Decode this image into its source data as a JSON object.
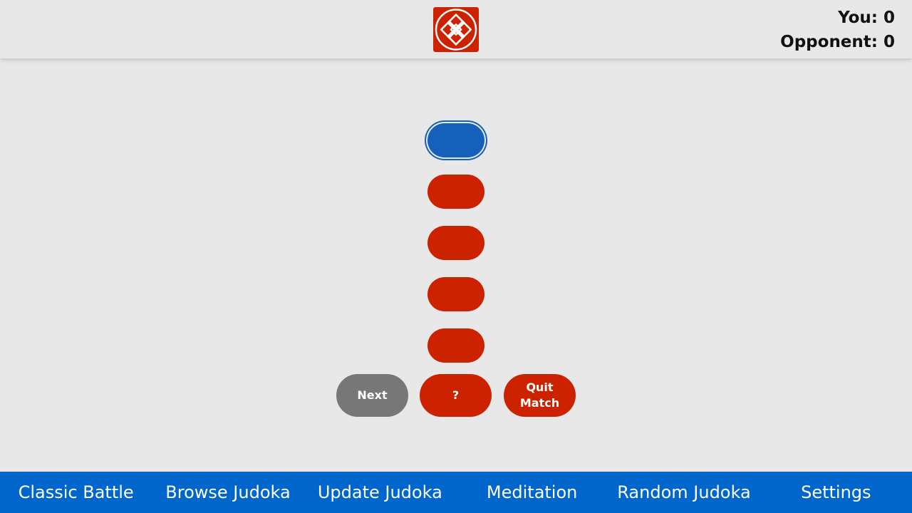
{
  "header": {
    "logo_icon": "endless-knot-logo-icon",
    "logo_color": "#cc2200",
    "scores": {
      "player": "You: 0",
      "opponent": "Opponent: 0"
    }
  },
  "stats": {
    "selected_index": 0,
    "buttons": [
      "",
      "",
      "",
      "",
      ""
    ],
    "selected_color": "#1560b8",
    "default_color": "#cc2200"
  },
  "controls": {
    "next_label": "Next",
    "help_label": "?",
    "quit_label": "Quit Match"
  },
  "nav": {
    "items": [
      "Classic Battle",
      "Browse Judoka",
      "Update Judoka",
      "Meditation",
      "Random Judoka",
      "Settings"
    ],
    "color": "#0066cc"
  }
}
